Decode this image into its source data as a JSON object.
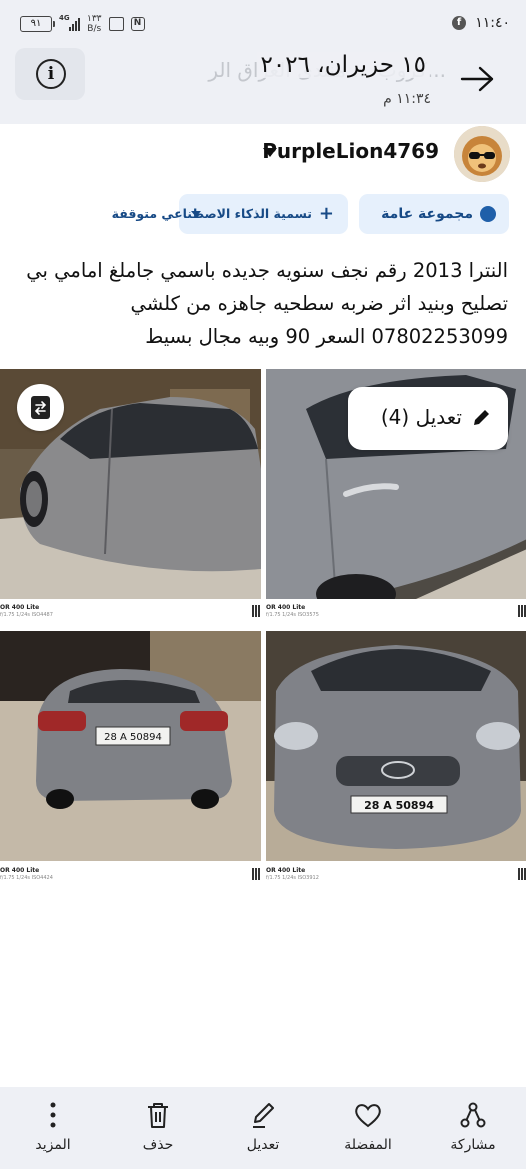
{
  "status_bar": {
    "time": "١١:٤٠",
    "app_icon": "facebook-icon",
    "battery": "٩١",
    "network": "4G",
    "speed_value": "١٣٣",
    "speed_unit": "B/s"
  },
  "header": {
    "date": "١٥ حزيران، ٢٠٢٦",
    "time": "١١:٣٤ م",
    "ghost_title": "كروب ... منتدى العراق الر..."
  },
  "user": {
    "name": "PurpleLion4769"
  },
  "chips": {
    "audience": "مجموعة عامة",
    "ai_label": "تسمية الذكاء الاصطناعي متوقفة"
  },
  "post": {
    "text": "النترا 2013 رقم نجف سنويه جديده باسمي جاملغ امامي بي تصليح وبنيد اثر ضربه سطحيه جاهزه من كلشي 07802253099 السعر 90 وبيه مجال بسيط"
  },
  "photos": {
    "edit_label": "تعديل (4)",
    "meta": [
      {
        "line1": "OR 400 Lite",
        "line2": "f/1.75 1/24s ISO4487"
      },
      {
        "line1": "OR 400 Lite",
        "line2": "f/1.75 1/24s ISO3575"
      },
      {
        "line1": "OR 400 Lite",
        "line2": "f/1.75 1/24s ISO4424"
      },
      {
        "line1": "OR 400 Lite",
        "line2": "f/1.75 1/24s ISO3912"
      }
    ],
    "plate_front": "28 A 50894",
    "plate_rear": "28 A 50894"
  },
  "bottom_nav": {
    "share": "مشاركة",
    "favorite": "المفضلة",
    "edit": "تعديل",
    "delete": "حذف",
    "more": "المزيد"
  }
}
